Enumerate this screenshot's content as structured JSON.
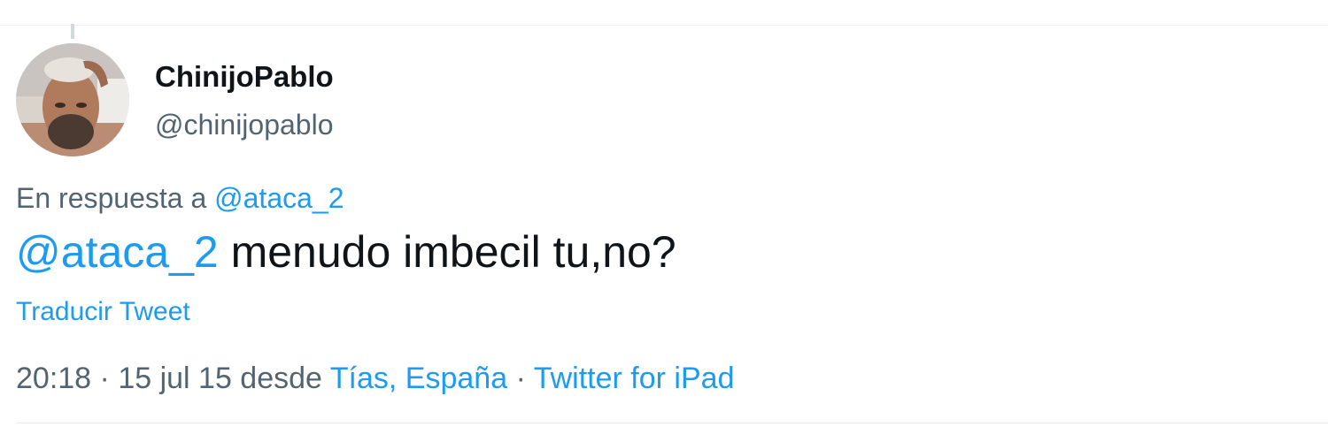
{
  "tweet": {
    "author": {
      "display_name": "ChinijoPablo",
      "handle": "@chinijopablo",
      "avatar_icon": "user-avatar-photo"
    },
    "reply_context": {
      "prefix": "En respuesta a",
      "mention": "@ataca_2"
    },
    "body": {
      "mention": "@ataca_2",
      "text": " menudo imbecil tu,no?"
    },
    "translate_label": "Traducir Tweet",
    "meta": {
      "time": "20:18",
      "separator": " · ",
      "date": "15 jul 15",
      "from_word": " desde ",
      "location": "Tías, España",
      "separator2": " · ",
      "source": "Twitter for iPad"
    }
  },
  "colors": {
    "link": "#1d9bf0",
    "text_primary": "#0f1419",
    "text_secondary": "#536471",
    "divider": "#eff3f4"
  }
}
